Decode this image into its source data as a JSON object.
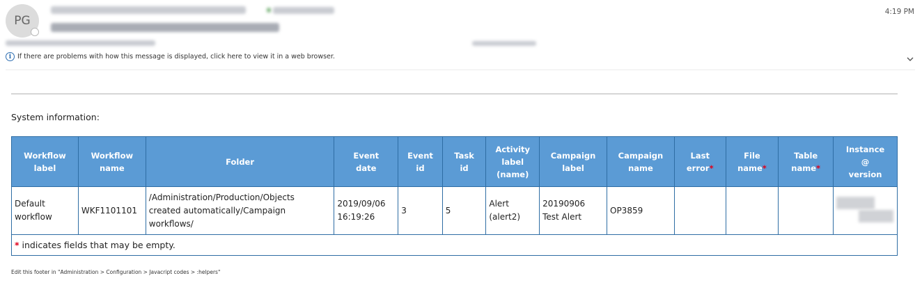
{
  "header": {
    "avatar_initials": "PG",
    "time": "4:19 PM",
    "info_text": "If there are problems with how this message is displayed, click here to view it in a web browser."
  },
  "content": {
    "section_title": "System information:",
    "table": {
      "headers": [
        [
          "Workflow",
          "label"
        ],
        [
          "Workflow",
          "name"
        ],
        [
          "Folder"
        ],
        [
          "Event",
          "date"
        ],
        [
          "Event",
          "id"
        ],
        [
          "Task",
          "id"
        ],
        [
          "Activity",
          "label",
          "(name)"
        ],
        [
          "Campaign",
          "label"
        ],
        [
          "Campaign",
          "name"
        ],
        [
          "Last",
          "error"
        ],
        [
          "File",
          "name"
        ],
        [
          "Table",
          "name"
        ],
        [
          "Instance",
          "@",
          "version"
        ]
      ],
      "required_marker": "*",
      "row": {
        "workflow_label": [
          "Default",
          "workflow"
        ],
        "workflow_name": "WKF1101101",
        "folder": [
          "/Administration/Production/Objects",
          "created automatically/Campaign",
          "workflows/"
        ],
        "event_date": [
          "2019/09/06",
          "16:19:26"
        ],
        "event_id": "3",
        "task_id": "5",
        "activity_label": "Alert (alert2)",
        "campaign_label": [
          "20190906",
          "Test Alert"
        ],
        "campaign_name": "OP3859",
        "last_error": "",
        "file_name": "",
        "table_name": ""
      },
      "footnote_marker": "*",
      "footnote_text": " indicates fields that may be empty."
    }
  },
  "footer": {
    "text": "Edit this footer in \"Administration > Configuration > Javacript codes >     :helpers\""
  },
  "colors": {
    "table_header_bg": "#5b9bd5",
    "table_border": "#2e6da4",
    "required_marker": "#e0001b"
  }
}
